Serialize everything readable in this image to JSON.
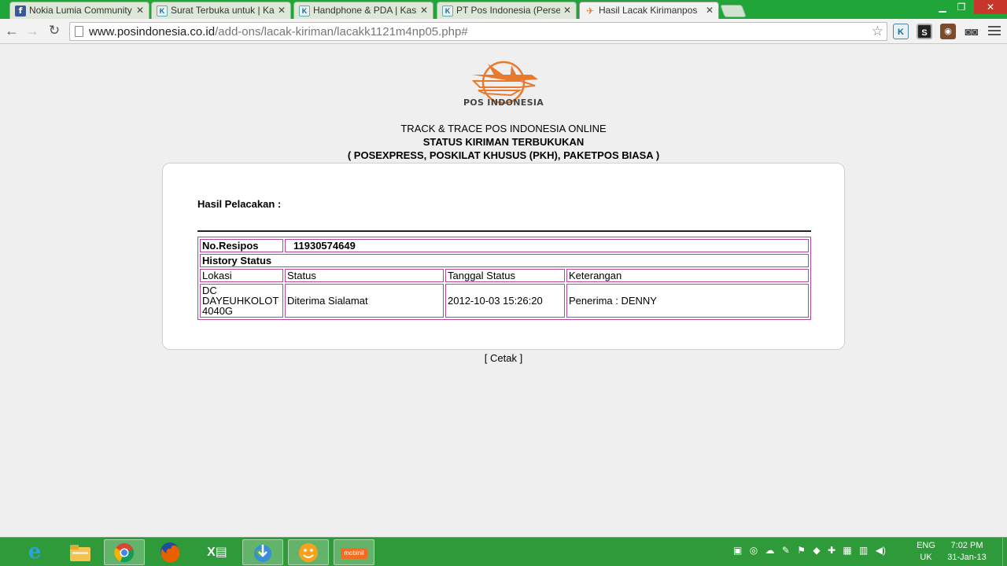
{
  "browser": {
    "tabs": [
      {
        "title": "Nokia Lumia Community",
        "icon": "facebook-icon"
      },
      {
        "title": "Surat Terbuka untuk | Kask",
        "icon": "kaskus-icon"
      },
      {
        "title": "Handphone & PDA | Kask",
        "icon": "kaskus-icon"
      },
      {
        "title": "PT Pos Indonesia (Persero",
        "icon": "kaskus-icon"
      },
      {
        "title": "Hasil Lacak Kirimanpos",
        "icon": "pos-indonesia-icon"
      }
    ],
    "address": {
      "host": "www.posindonesia.co.id",
      "path": "/add-ons/lacak-kiriman/lacakk1121m4np05.php#"
    }
  },
  "page": {
    "logo_text": "POS INDONESIA",
    "heading_line1": "TRACK & TRACE POS INDONESIA ONLINE",
    "heading_line2": "STATUS KIRIMAN TERBUKUKAN",
    "heading_line3": "( POSEXPRESS, POSKILAT KHUSUS (PKH), PAKETPOS BIASA )",
    "result_label": "Hasil Pelacakan :",
    "receipt_label": "No.Resipos",
    "receipt_value": "11930574649",
    "history_label": "History Status",
    "columns": [
      "Lokasi",
      "Status",
      "Tanggal Status",
      "Keterangan"
    ],
    "rows": [
      {
        "lokasi_lines": [
          "DC",
          "DAYEUHKOLOT",
          "4040G"
        ],
        "status": "Diterima Sialamat",
        "tanggal": "2012-10-03 15:26:20",
        "keterangan": "Penerima : DENNY"
      }
    ],
    "print_link": "[ Cetak ]"
  },
  "taskbar": {
    "excel_label": "X",
    "mobinil_label": "mobinil",
    "language": "ENG",
    "region": "UK",
    "time": "7:02 PM",
    "date": "31-Jan-13"
  }
}
